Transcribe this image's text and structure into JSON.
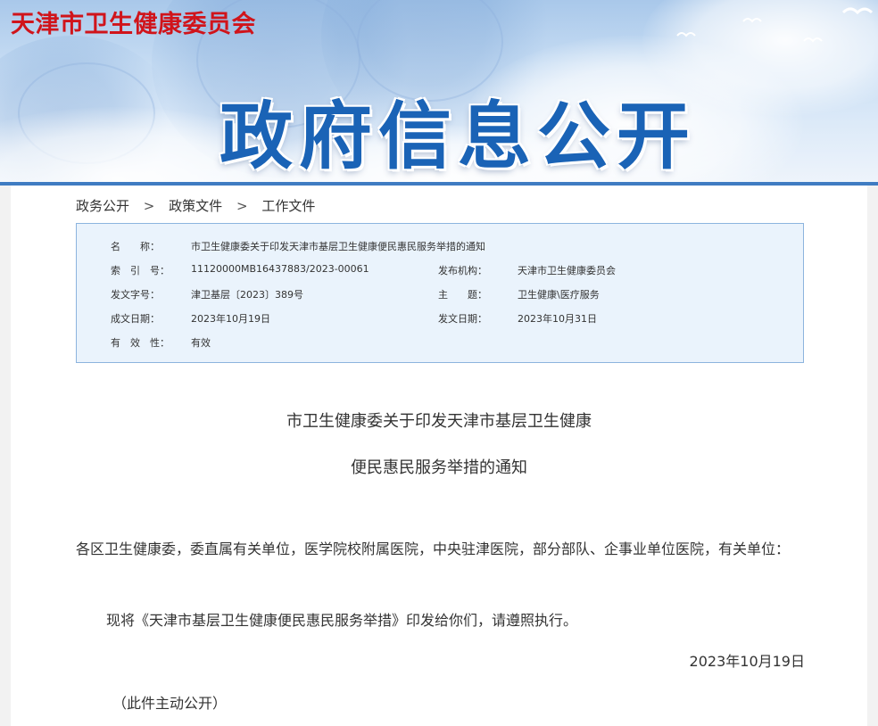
{
  "header": {
    "site_name": "天津市卫生健康委员会",
    "banner_title": "政府信息公开"
  },
  "breadcrumb": {
    "items": [
      "政务公开",
      "政策文件",
      "工作文件"
    ],
    "separator": ">"
  },
  "meta": {
    "name_label": "名　　称：",
    "name_value": "市卫生健康委关于印发天津市基层卫生健康便民惠民服务举措的通知",
    "index_label": "索　引　号：",
    "index_value": "11120000MB16437883/2023-00061",
    "issuer_label": "发布机构：",
    "issuer_value": "天津市卫生健康委员会",
    "doc_no_label": "发文字号：",
    "doc_no_value": "津卫基层〔2023〕389号",
    "topic_label": "主　　题：",
    "topic_value": "卫生健康\\医疗服务",
    "created_label": "成文日期：",
    "created_value": "2023年10月19日",
    "published_label": "发文日期：",
    "published_value": "2023年10月31日",
    "validity_label": "有　效　性：",
    "validity_value": "有效"
  },
  "document": {
    "title_line1": "市卫生健康委关于印发天津市基层卫生健康",
    "title_line2": "便民惠民服务举措的通知",
    "salutation": "各区卫生健康委，委直属有关单位，医学院校附属医院，中央驻津医院，部分部队、企事业单位医院，有关单位：",
    "body": "现将《天津市基层卫生健康便民惠民服务举措》印发给你们，请遵照执行。",
    "date": "2023年10月19日",
    "note": "（此件主动公开）"
  },
  "colors": {
    "site_name": "#d0141b",
    "banner_title": "#1a63b6",
    "meta_bg": "#eaf3fc",
    "meta_border": "#8cb4de"
  }
}
